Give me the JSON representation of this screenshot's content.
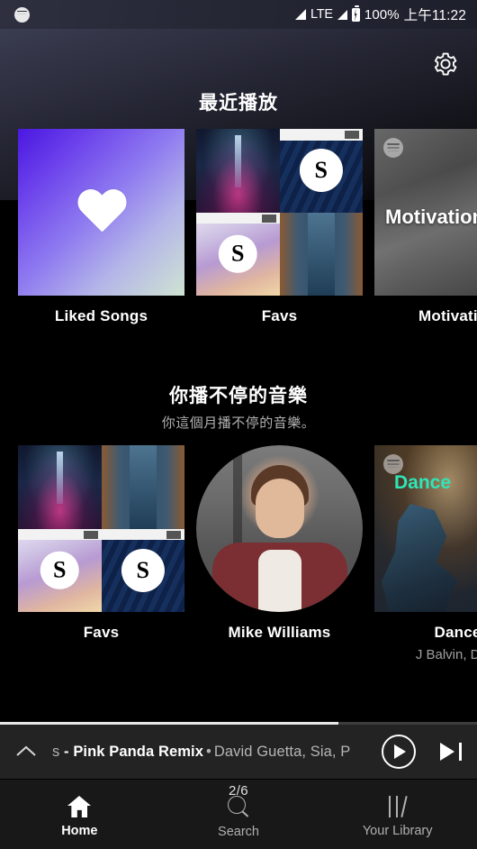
{
  "status_bar": {
    "app_icon": "spotify-icon",
    "network": "LTE",
    "battery_percent": "100%",
    "time": "上午11:22"
  },
  "header": {
    "settings_icon": "gear-icon"
  },
  "sections": [
    {
      "title": "最近播放",
      "subtitle": "",
      "cards": [
        {
          "label": "Liked Songs",
          "sub": "",
          "art": "liked-songs-gradient-heart"
        },
        {
          "label": "Favs",
          "sub": "",
          "art": "album-collage"
        },
        {
          "label": "Motivation",
          "sub": "",
          "art": "motivation-runner-photo",
          "overlay_title": "Motivation"
        }
      ]
    },
    {
      "title": "你播不停的音樂",
      "subtitle": "你這個月播不停的音樂。",
      "cards": [
        {
          "label": "Favs",
          "sub": "",
          "art": "album-collage"
        },
        {
          "label": "Mike Williams",
          "sub": "",
          "art": "artist-portrait-circle"
        },
        {
          "label": "Dance",
          "sub": "J Balvin, DJ S",
          "art": "dance-playlist-photo",
          "overlay_title": "Dance"
        }
      ]
    }
  ],
  "player": {
    "collapse_icon": "chevron-up-icon",
    "track_prefix": "s",
    "track_title": " - Pink Panda Remix",
    "separator": "•",
    "track_artist": "David Guetta, Sia, P",
    "play_icon": "play-icon",
    "next_icon": "skip-next-icon",
    "progress_percent": 71
  },
  "bottom_nav": {
    "items": [
      {
        "label": "Home",
        "icon": "home-icon",
        "active": true,
        "badge": ""
      },
      {
        "label": "Search",
        "icon": "search-icon",
        "active": false,
        "badge": "2/6"
      },
      {
        "label": "Your Library",
        "icon": "library-icon",
        "active": false,
        "badge": ""
      }
    ]
  },
  "colors": {
    "background": "#000000",
    "player_bg": "#232323",
    "nav_bg": "#181818",
    "accent_teal": "#2ee6b8",
    "muted_text": "#b0b0b0"
  }
}
